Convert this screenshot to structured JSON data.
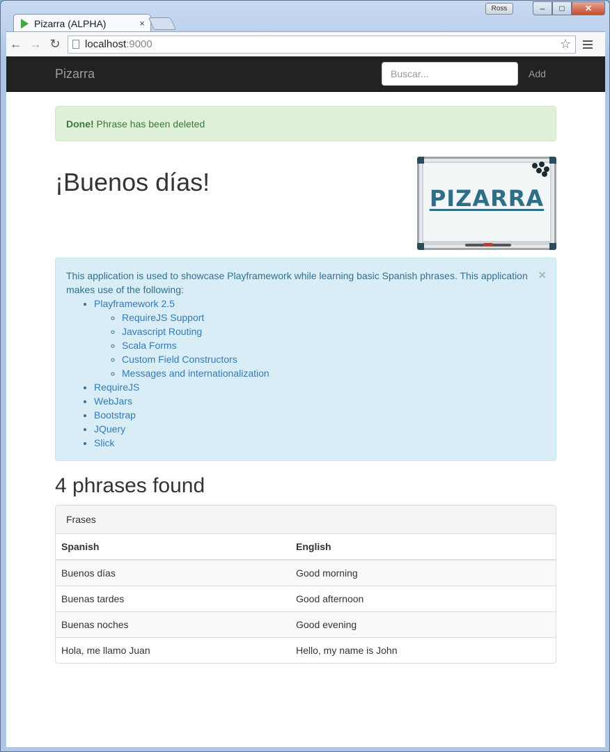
{
  "browser": {
    "tab_title": "Pizarra (ALPHA)",
    "tab_close": "×",
    "user": "Ross",
    "url_host": "localhost",
    "url_port": ":9000",
    "window_buttons": {
      "minimize": "–",
      "maximize": "□",
      "close": "✕"
    }
  },
  "navbar": {
    "brand": "Pizarra",
    "search_placeholder": "Buscar...",
    "add_label": "Add"
  },
  "flash": {
    "strong": "Done!",
    "message": " Phrase has been deleted"
  },
  "greeting": "¡Buenos días!",
  "logo": {
    "text": "PIZARRA"
  },
  "info": {
    "intro": "This application is used to showcase Playframework while learning basic Spanish phrases. This application makes use of the following:",
    "close": "×",
    "items": [
      {
        "label": "Playframework 2.5",
        "children": [
          "RequireJS Support",
          "Javascript Routing",
          "Scala Forms",
          "Custom Field Constructors",
          "Messages and internationalization"
        ]
      },
      {
        "label": "RequireJS"
      },
      {
        "label": "WebJars"
      },
      {
        "label": "Bootstrap"
      },
      {
        "label": "JQuery"
      },
      {
        "label": "Slick"
      }
    ]
  },
  "results": {
    "count_text": "4 phrases found",
    "panel_title": "Frases",
    "headers": [
      "Spanish",
      "English"
    ],
    "rows": [
      [
        "Buenos días",
        "Good morning"
      ],
      [
        "Buenas tardes",
        "Good afternoon"
      ],
      [
        "Buenas noches",
        "Good evening"
      ],
      [
        "Hola, me llamo Juan",
        "Hello, my name is John"
      ]
    ]
  }
}
